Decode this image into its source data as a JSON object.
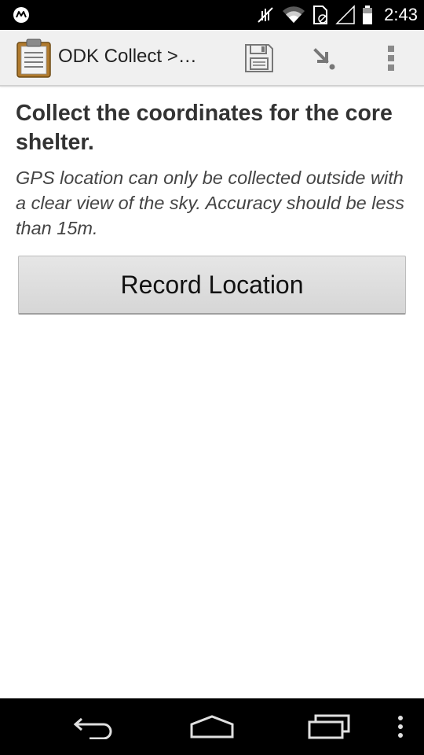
{
  "status_bar": {
    "time": "2:43",
    "icons": [
      "motorola-logo-icon",
      "vibrate-off-icon",
      "wifi-icon",
      "sim-icon",
      "signal-icon",
      "battery-icon"
    ]
  },
  "action_bar": {
    "title": "ODK Collect >…",
    "icons": [
      "clipboard-app-icon",
      "save-icon",
      "jump-to-icon",
      "overflow-menu-icon"
    ]
  },
  "question": {
    "title": "Collect the coordinates for the core shelter.",
    "hint": "GPS location can only be collected outside with a clear view of the sky. Accuracy should be less than 15m.",
    "button_label": "Record Location"
  },
  "nav_bar": {
    "icons": [
      "back-icon",
      "home-icon",
      "recents-icon",
      "menu-icon"
    ]
  },
  "colors": {
    "status_bar_bg": "#000000",
    "action_bar_bg": "#f0f0f0",
    "page_bg": "#ffffff",
    "button_bg": "#dddddd",
    "title_text": "#333333"
  }
}
